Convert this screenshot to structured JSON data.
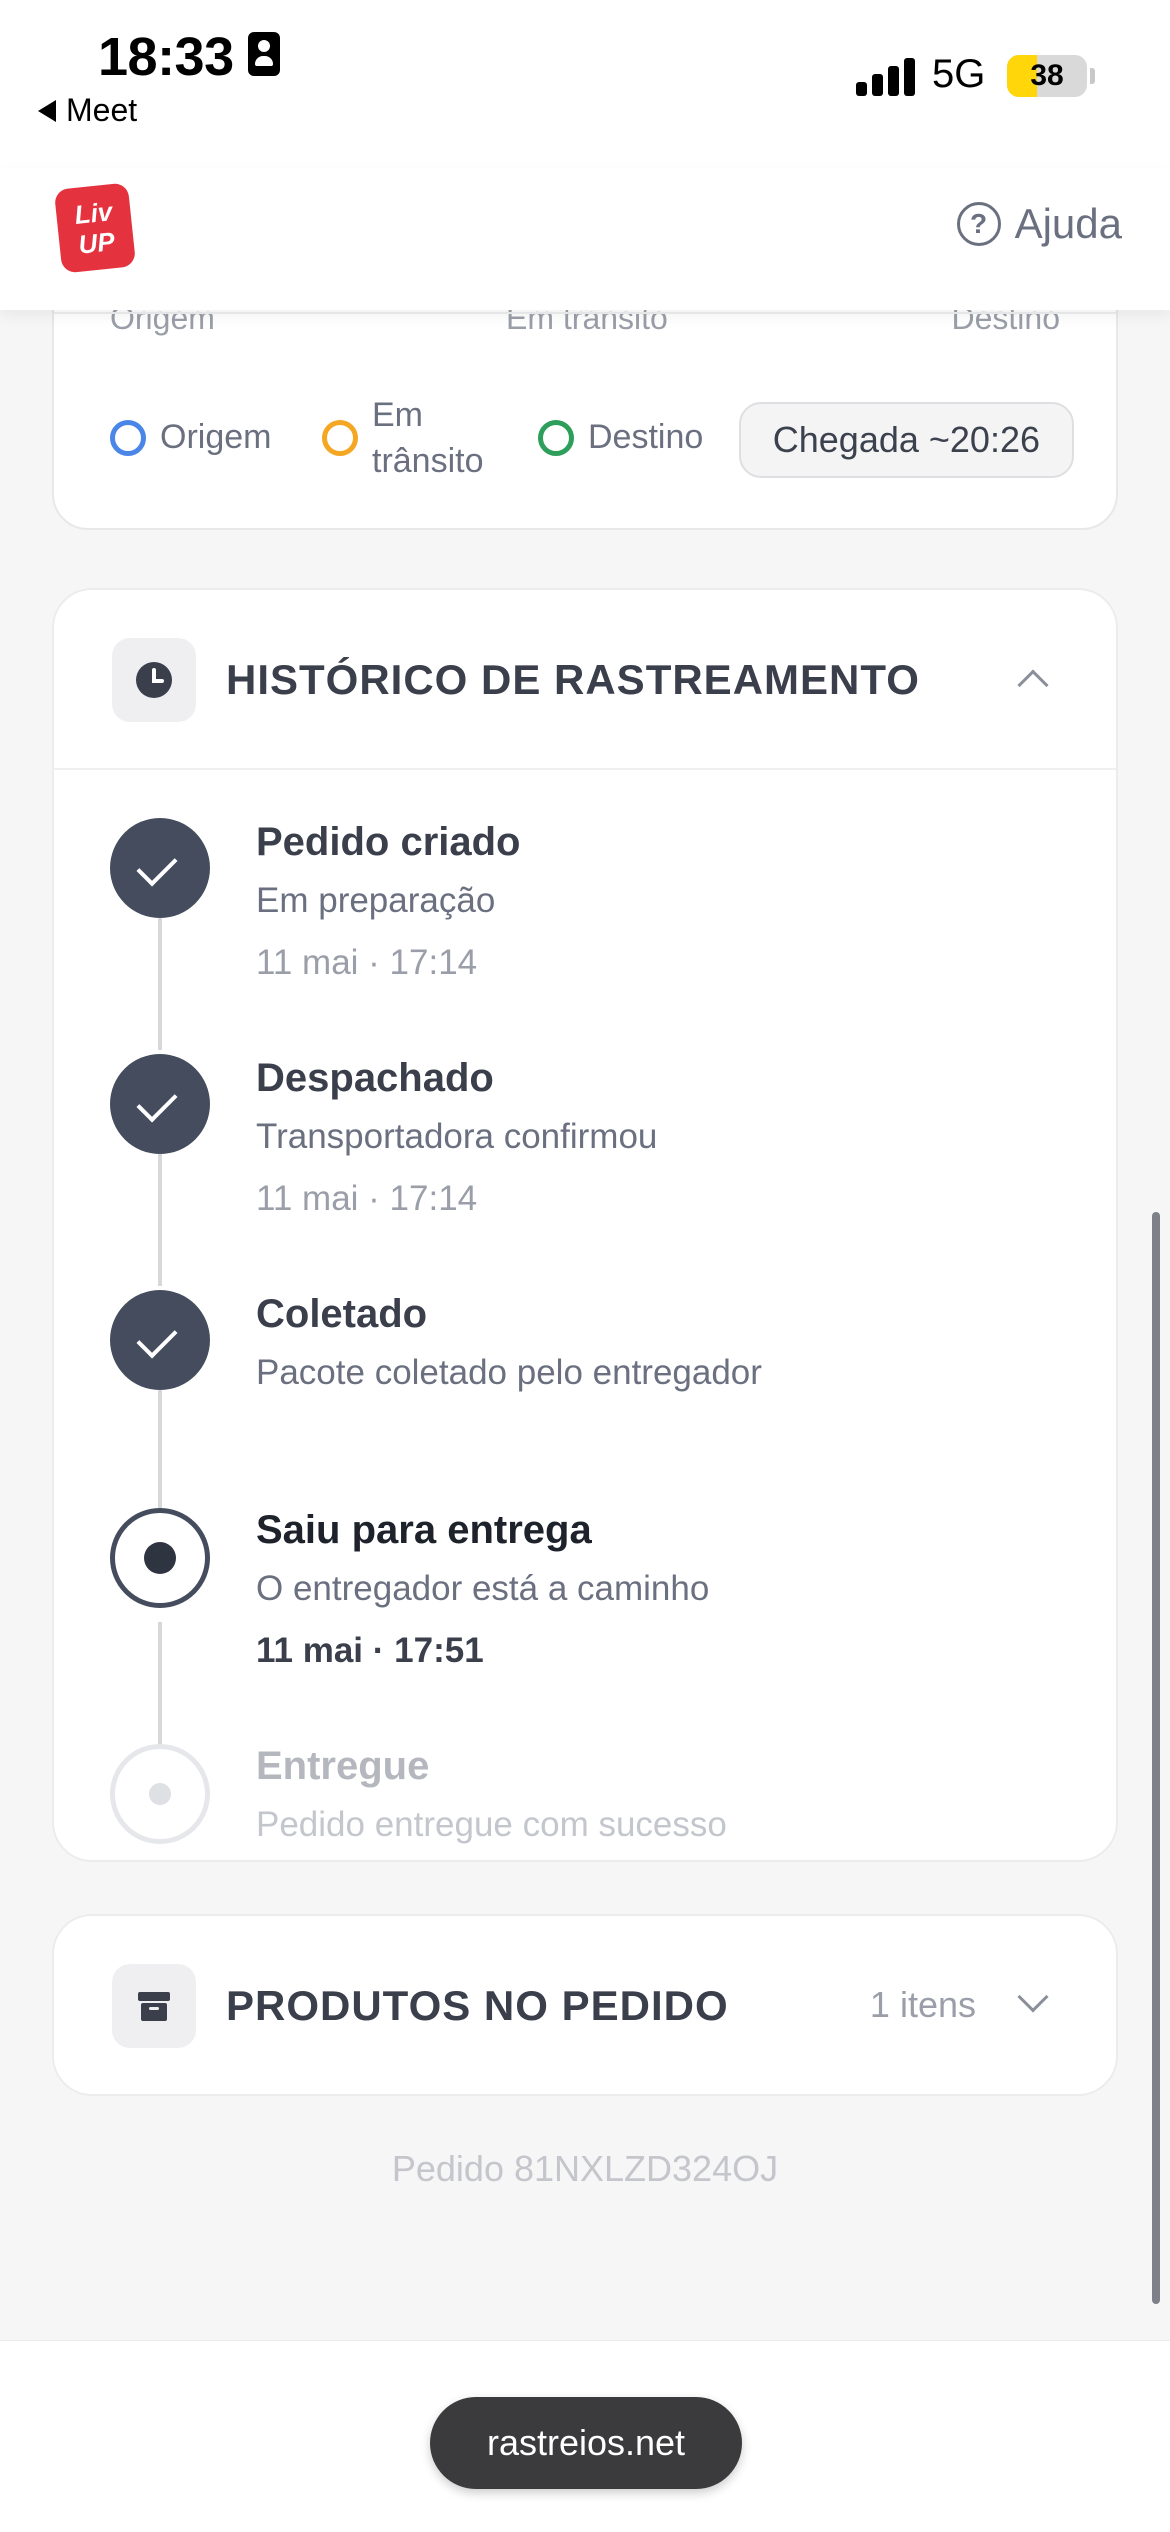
{
  "status_bar": {
    "time": "18:33",
    "back_app": "Meet",
    "network": "5G",
    "battery": "38",
    "battery_level": 0.38
  },
  "header": {
    "logo_text_line1": "Liv",
    "logo_text_line2": "UP",
    "help_label": "Ajuda",
    "brand_color": "#e5323f"
  },
  "map_card": {
    "strip_labels": [
      "Origem",
      "Em trânsito",
      "Destino"
    ],
    "legend": [
      {
        "label": "Origem",
        "color": "#4a86e8"
      },
      {
        "label": "Em trânsito",
        "color": "#f5a623"
      },
      {
        "label": "Destino",
        "color": "#2e9e5b"
      }
    ],
    "arrival": "Chegada ~20:26"
  },
  "history": {
    "title": "HISTÓRICO DE RASTREAMENTO",
    "events": [
      {
        "title": "Pedido criado",
        "subtitle": "Em preparação",
        "time": "11 mai · 17:14",
        "state": "done"
      },
      {
        "title": "Despachado",
        "subtitle": "Transportadora confirmou",
        "time": "11 mai · 17:14",
        "state": "done"
      },
      {
        "title": "Coletado",
        "subtitle": "Pacote coletado pelo entregador",
        "time": "",
        "state": "done"
      },
      {
        "title": "Saiu para entrega",
        "subtitle": "O entregador está a caminho",
        "time": "11 mai · 17:51",
        "state": "current"
      },
      {
        "title": "Entregue",
        "subtitle": "Pedido entregue com sucesso",
        "time": "",
        "state": "future"
      }
    ]
  },
  "products": {
    "title": "PRODUTOS NO PEDIDO",
    "count": "1 itens"
  },
  "order_id": "Pedido 81NXLZD324OJ",
  "bottom_bar": {
    "url": "rastreios.net"
  }
}
